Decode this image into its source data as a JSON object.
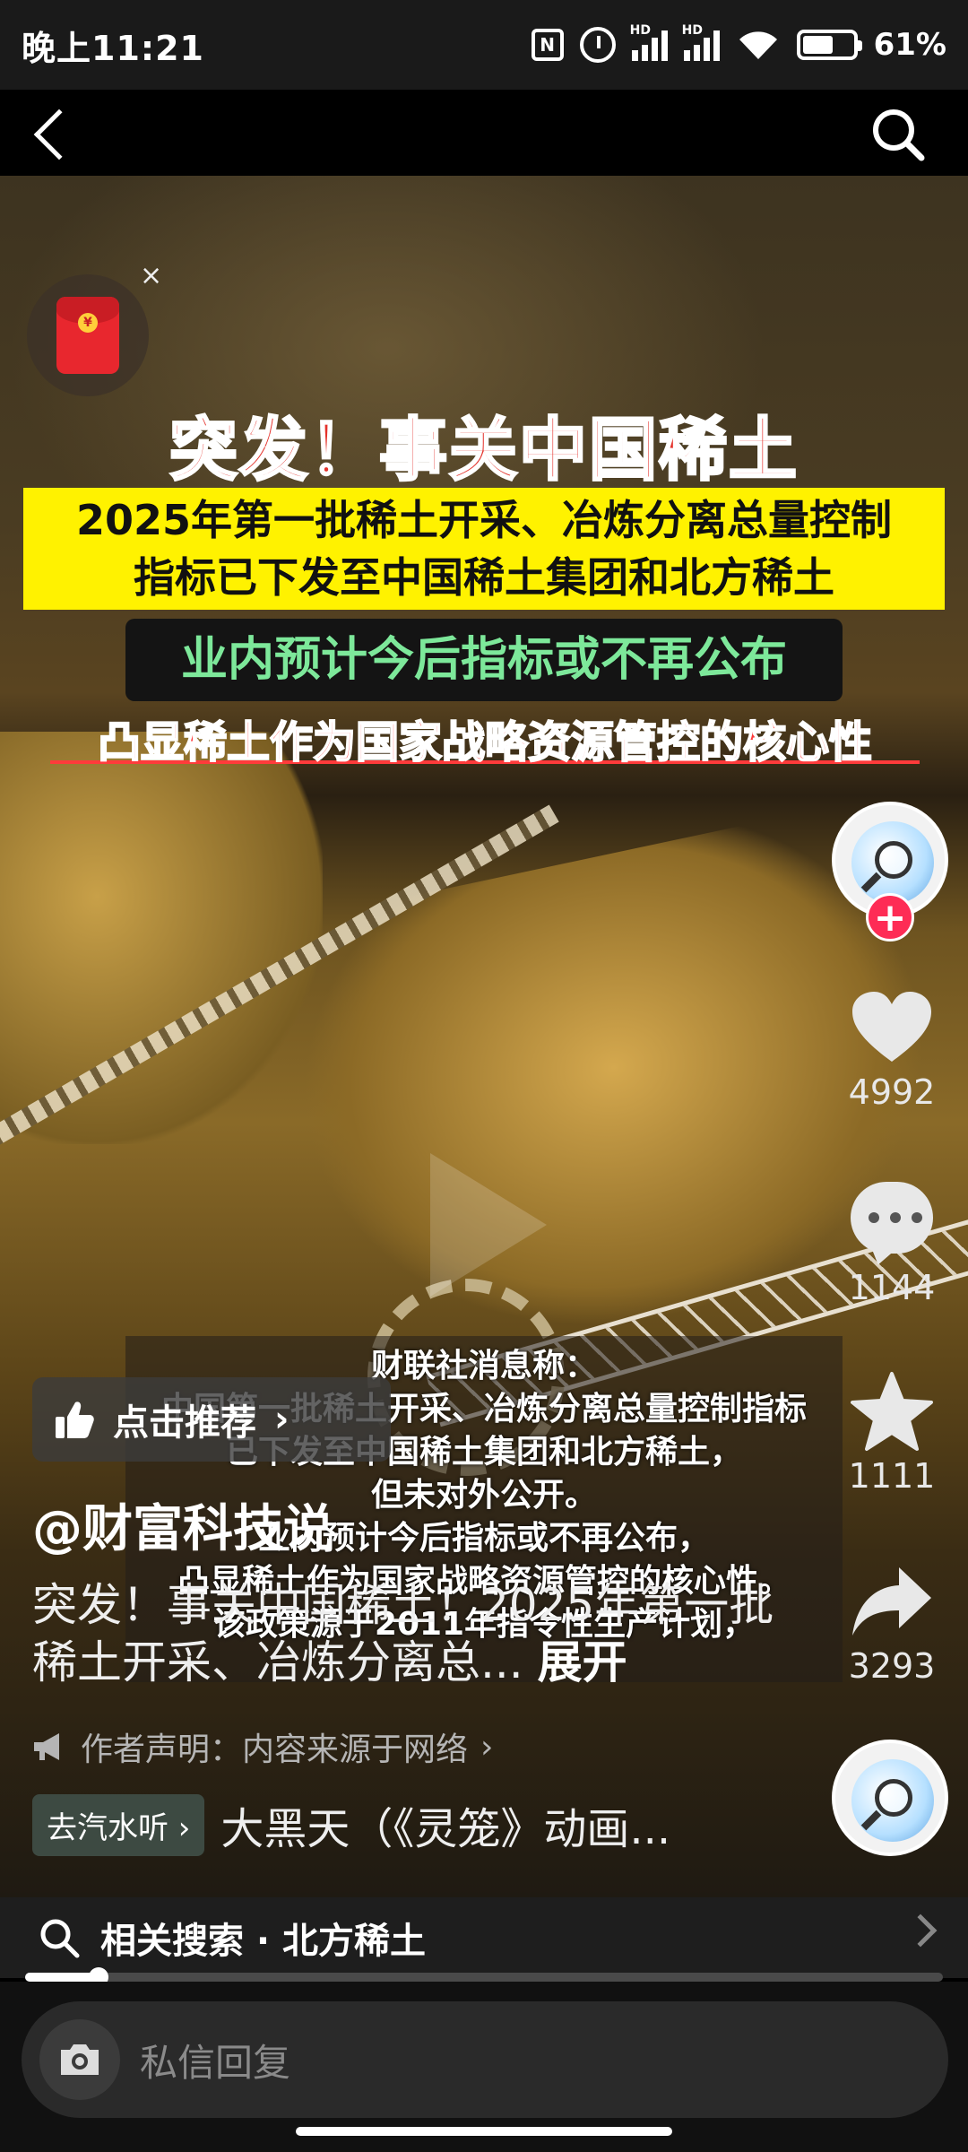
{
  "status_bar": {
    "time": "晚上11:21",
    "nfc": "N",
    "signal_tag": "HD",
    "battery_level": 61,
    "battery": "61%"
  },
  "nav": {
    "back_icon": "chevron-left-icon",
    "search_icon": "search-icon"
  },
  "video": {
    "headline_1": "突发！事关中国稀土",
    "headline_2_line1": "2025年第一批稀土开采、冶炼分离总量控制",
    "headline_2_line2": "指标已下发至中国稀土集团和北方稀土",
    "headline_3": "业内预计今后指标或不再公布",
    "headline_4": "凸显稀土作为国家战略资源管控的核心性",
    "caption_lines": [
      "财联社消息称：",
      "中国第一批稀土开采、冶炼分离总量控制指标",
      "已下发至中国稀土集团和北方稀土，",
      "但未对外公开。",
      "业内预计今后指标或不再公布，",
      "凸显稀土作为国家战略资源管控的核心性。",
      "该政策源于2011年指令性生产计划，"
    ],
    "red_packet_close": "×",
    "red_packet_coin": "¥"
  },
  "rail": {
    "follow_plus": "+",
    "likes": "4992",
    "comments": "1144",
    "favorites": "1111",
    "shares": "3293"
  },
  "recommend": {
    "label": "点击推荐",
    "arrow": "›"
  },
  "post": {
    "author": "@财富科技说",
    "description": "突发！事关中国稀土！2025年第一批稀土开采、冶炼分离总...",
    "expand": "展开",
    "claim": "作者声明：内容来源于网络",
    "claim_arrow": "›",
    "music_badge": "去汽水听 ›",
    "music_title": "大黑天（《灵笼》动画..."
  },
  "related": {
    "label": "相关搜索 · 北方稀土"
  },
  "progress": {
    "played": 0.08
  },
  "reply": {
    "placeholder": "私信回复"
  }
}
